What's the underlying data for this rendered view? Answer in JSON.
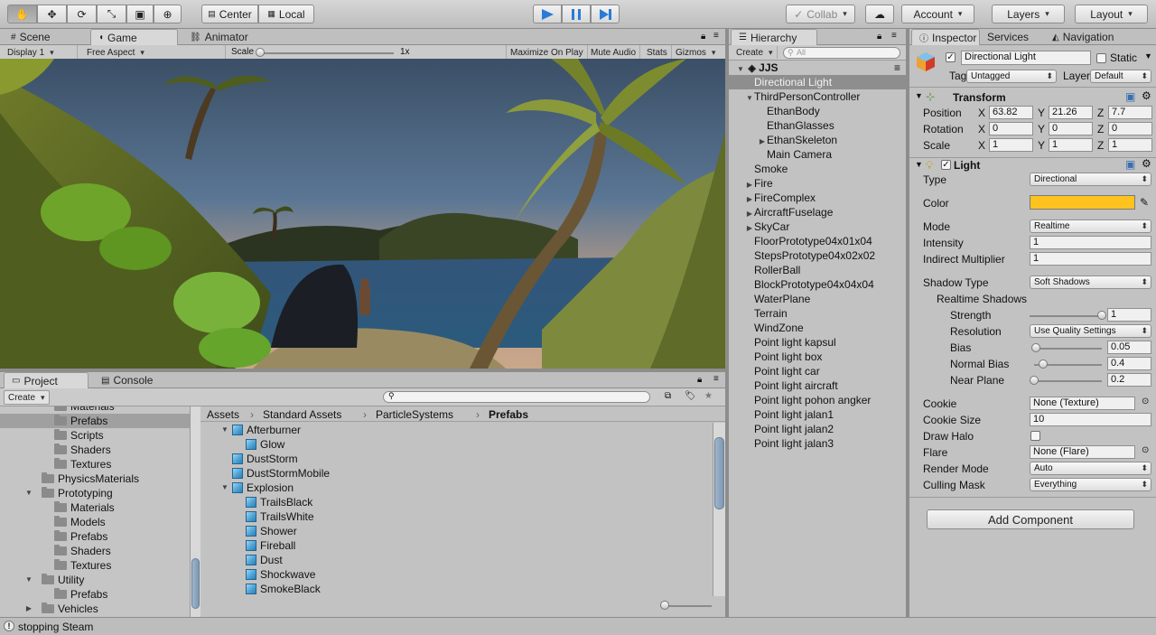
{
  "toolbar": {
    "tools": [
      "hand-tool",
      "move-tool",
      "rotate-tool",
      "scale-tool",
      "rect-tool",
      "transform-tool"
    ],
    "pivot_label": "Center",
    "space_label": "Local",
    "collab_label": "Collab",
    "account_label": "Account",
    "layers_label": "Layers",
    "layout_label": "Layout"
  },
  "scene_panel": {
    "tabs": [
      "Scene",
      "Game",
      "Animator"
    ],
    "display": "Display 1",
    "aspect": "Free Aspect",
    "scale_label": "Scale",
    "scale_value": "1x",
    "scale_fraction": 0.0,
    "maximize": "Maximize On Play",
    "mute": "Mute Audio",
    "stats": "Stats",
    "gizmos": "Gizmos"
  },
  "hierarchy": {
    "tab": "Hierarchy",
    "create": "Create",
    "search_placeholder": "All",
    "scene_name": "JJS",
    "items": [
      {
        "label": "Directional Light",
        "depth": 1,
        "arrow": "",
        "selected": true
      },
      {
        "label": "ThirdPersonController",
        "depth": 1,
        "arrow": "▼"
      },
      {
        "label": "EthanBody",
        "depth": 2,
        "arrow": ""
      },
      {
        "label": "EthanGlasses",
        "depth": 2,
        "arrow": ""
      },
      {
        "label": "EthanSkeleton",
        "depth": 2,
        "arrow": "▶"
      },
      {
        "label": "Main Camera",
        "depth": 2,
        "arrow": ""
      },
      {
        "label": "Smoke",
        "depth": 1,
        "arrow": ""
      },
      {
        "label": "Fire",
        "depth": 1,
        "arrow": "▶"
      },
      {
        "label": "FireComplex",
        "depth": 1,
        "arrow": "▶"
      },
      {
        "label": "AircraftFuselage",
        "depth": 1,
        "arrow": "▶"
      },
      {
        "label": "SkyCar",
        "depth": 1,
        "arrow": "▶"
      },
      {
        "label": "FloorPrototype04x01x04",
        "depth": 1,
        "arrow": ""
      },
      {
        "label": "StepsPrototype04x02x02",
        "depth": 1,
        "arrow": ""
      },
      {
        "label": "RollerBall",
        "depth": 1,
        "arrow": ""
      },
      {
        "label": "BlockPrototype04x04x04",
        "depth": 1,
        "arrow": ""
      },
      {
        "label": "WaterPlane",
        "depth": 1,
        "arrow": ""
      },
      {
        "label": "Terrain",
        "depth": 1,
        "arrow": ""
      },
      {
        "label": "WindZone",
        "depth": 1,
        "arrow": ""
      },
      {
        "label": "Point light kapsul",
        "depth": 1,
        "arrow": ""
      },
      {
        "label": "Point light box",
        "depth": 1,
        "arrow": ""
      },
      {
        "label": "Point light car",
        "depth": 1,
        "arrow": ""
      },
      {
        "label": "Point light aircraft",
        "depth": 1,
        "arrow": ""
      },
      {
        "label": "Point light pohon angker",
        "depth": 1,
        "arrow": ""
      },
      {
        "label": "Point light jalan1",
        "depth": 1,
        "arrow": ""
      },
      {
        "label": "Point light jalan2",
        "depth": 1,
        "arrow": ""
      },
      {
        "label": "Point light jalan3",
        "depth": 1,
        "arrow": ""
      }
    ]
  },
  "inspector": {
    "tabs": [
      "Inspector",
      "Services",
      "Navigation"
    ],
    "object_name": "Directional Light",
    "static_label": "Static",
    "tag_label": "Tag",
    "tag_value": "Untagged",
    "layer_label": "Layer",
    "layer_value": "Default",
    "transform": {
      "title": "Transform",
      "rows": [
        {
          "label": "Position",
          "x": "63.82",
          "y": "21.26",
          "z": "7.7"
        },
        {
          "label": "Rotation",
          "x": "0",
          "y": "0",
          "z": "0"
        },
        {
          "label": "Scale",
          "x": "1",
          "y": "1",
          "z": "1"
        }
      ]
    },
    "light": {
      "title": "Light",
      "type_label": "Type",
      "type_value": "Directional",
      "color_label": "Color",
      "color_value": "#ffc31f",
      "mode_label": "Mode",
      "mode_value": "Realtime",
      "intensity_label": "Intensity",
      "intensity_value": "1",
      "indirect_label": "Indirect Multiplier",
      "indirect_value": "1",
      "shadow_type_label": "Shadow Type",
      "shadow_type_value": "Soft Shadows",
      "realtime_shadows_label": "Realtime Shadows",
      "strength_label": "Strength",
      "strength_value": "1",
      "strength_fraction": 1.0,
      "resolution_label": "Resolution",
      "resolution_value": "Use Quality Settings",
      "bias_label": "Bias",
      "bias_value": "0.05",
      "bias_fraction": 0.025,
      "normal_bias_label": "Normal Bias",
      "normal_bias_value": "0.4",
      "normal_bias_fraction": 0.13,
      "near_plane_label": "Near Plane",
      "near_plane_value": "0.2",
      "near_plane_fraction": 0.0,
      "cookie_label": "Cookie",
      "cookie_value": "None (Texture)",
      "cookie_size_label": "Cookie Size",
      "cookie_size_value": "10",
      "draw_halo_label": "Draw Halo",
      "flare_label": "Flare",
      "flare_value": "None (Flare)",
      "render_mode_label": "Render Mode",
      "render_mode_value": "Auto",
      "culling_mask_label": "Culling Mask",
      "culling_mask_value": "Everything"
    },
    "add_component": "Add Component"
  },
  "project": {
    "tabs": [
      "Project",
      "Console"
    ],
    "create": "Create",
    "breadcrumb": [
      "Assets",
      "Standard Assets",
      "ParticleSystems",
      "Prefabs"
    ],
    "tree": [
      {
        "label": "Materials",
        "indent": 60,
        "arrow": "",
        "partial": true
      },
      {
        "label": "Prefabs",
        "indent": 60,
        "arrow": "",
        "selected": true
      },
      {
        "label": "Scripts",
        "indent": 60,
        "arrow": ""
      },
      {
        "label": "Shaders",
        "indent": 60,
        "arrow": ""
      },
      {
        "label": "Textures",
        "indent": 60,
        "arrow": ""
      },
      {
        "label": "PhysicsMaterials",
        "indent": 46,
        "arrow": ""
      },
      {
        "label": "Prototyping",
        "indent": 46,
        "arrow": "▼"
      },
      {
        "label": "Materials",
        "indent": 60,
        "arrow": ""
      },
      {
        "label": "Models",
        "indent": 60,
        "arrow": ""
      },
      {
        "label": "Prefabs",
        "indent": 60,
        "arrow": ""
      },
      {
        "label": "Shaders",
        "indent": 60,
        "arrow": ""
      },
      {
        "label": "Textures",
        "indent": 60,
        "arrow": ""
      },
      {
        "label": "Utility",
        "indent": 46,
        "arrow": "▼"
      },
      {
        "label": "Prefabs",
        "indent": 60,
        "arrow": ""
      },
      {
        "label": "Vehicles",
        "indent": 46,
        "arrow": "▶"
      }
    ],
    "assets": [
      {
        "label": "Afterburner",
        "indent": 257,
        "arrow": "▼"
      },
      {
        "label": "Glow",
        "indent": 272,
        "arrow": ""
      },
      {
        "label": "DustStorm",
        "indent": 257,
        "arrow": ""
      },
      {
        "label": "DustStormMobile",
        "indent": 257,
        "arrow": ""
      },
      {
        "label": "Explosion",
        "indent": 257,
        "arrow": "▼"
      },
      {
        "label": "TrailsBlack",
        "indent": 272,
        "arrow": ""
      },
      {
        "label": "TrailsWhite",
        "indent": 272,
        "arrow": ""
      },
      {
        "label": "Shower",
        "indent": 272,
        "arrow": ""
      },
      {
        "label": "Fireball",
        "indent": 272,
        "arrow": ""
      },
      {
        "label": "Dust",
        "indent": 272,
        "arrow": ""
      },
      {
        "label": "Shockwave",
        "indent": 272,
        "arrow": ""
      },
      {
        "label": "SmokeBlack",
        "indent": 272,
        "arrow": ""
      }
    ]
  },
  "status": {
    "message": "stopping Steam"
  }
}
